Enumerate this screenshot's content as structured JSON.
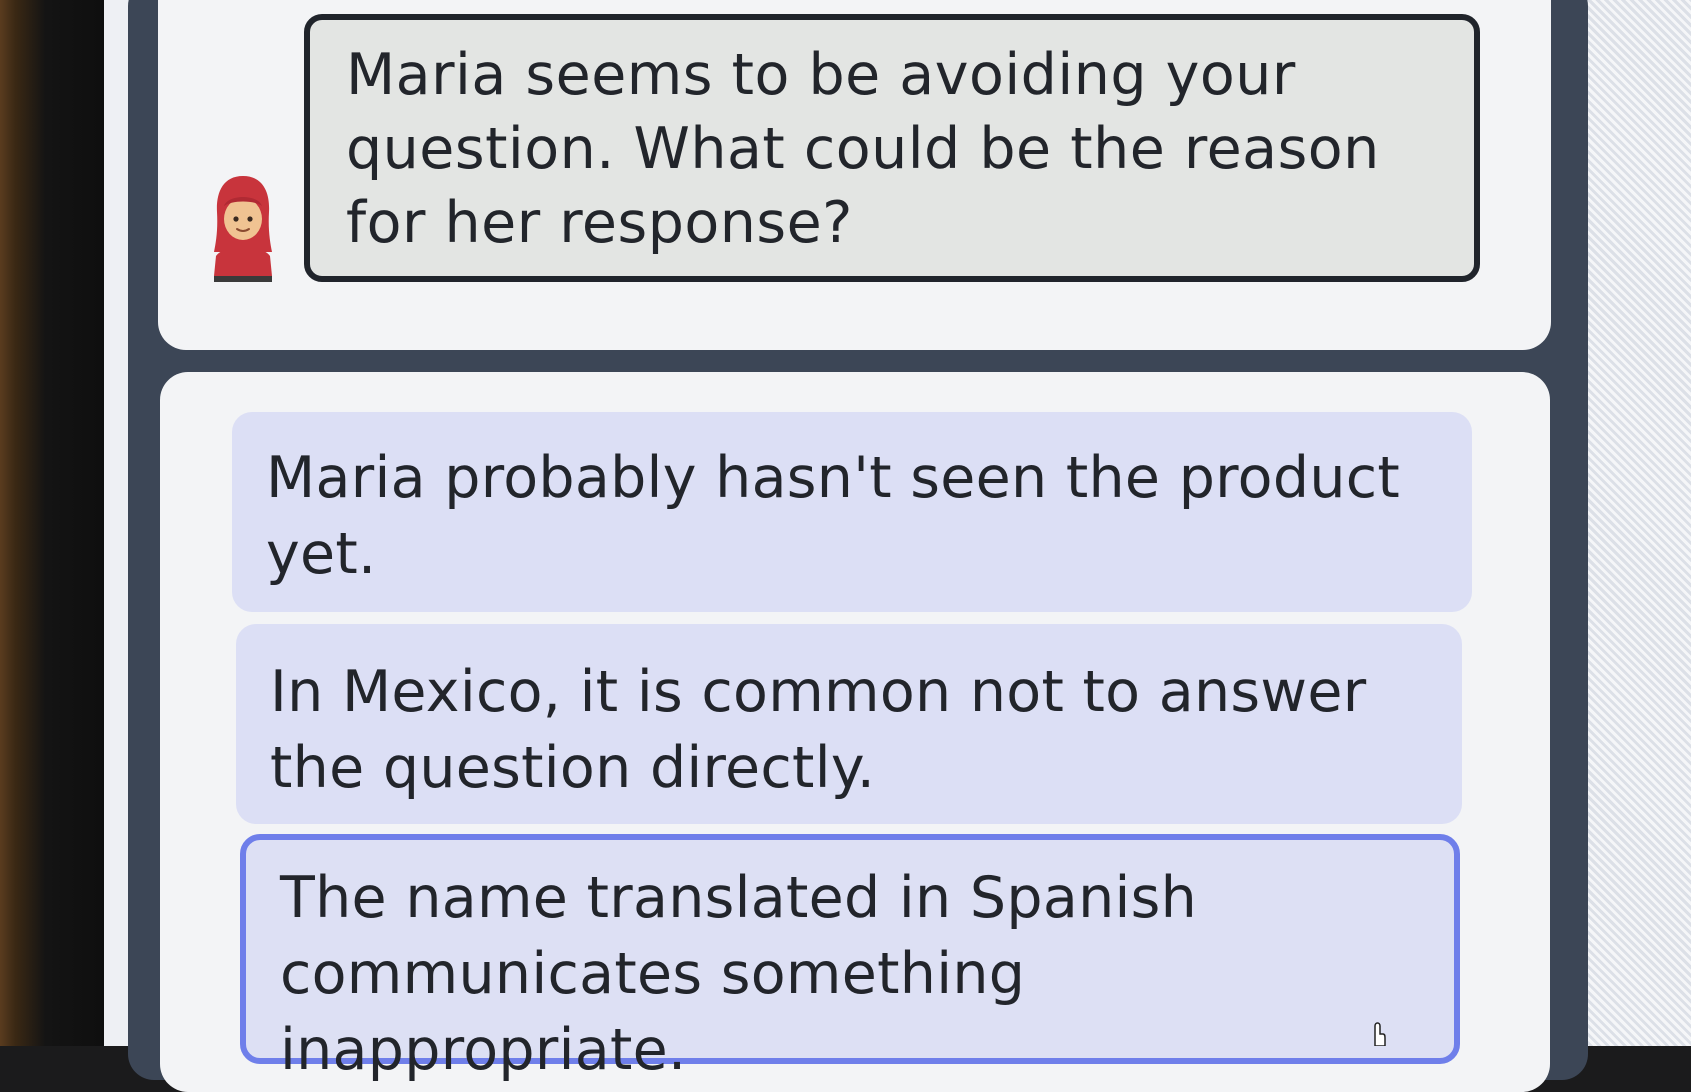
{
  "prompt": {
    "text": "Maria seems to be avoiding your question. What could be the reason for her response?",
    "avatar_icon": "woman-with-headscarf-icon"
  },
  "options": [
    {
      "text": "Maria probably hasn't seen the product yet."
    },
    {
      "text": "In Mexico, it is common not to answer the question directly."
    },
    {
      "text": "The name translated in Spanish communicates something inappropriate.",
      "state": "hovered"
    }
  ],
  "colors": {
    "frame": "#3c4656",
    "card": "#f3f4f6",
    "prompt_box_bg": "#e3e5e3",
    "prompt_border": "#20242b",
    "option_bg": "#dcdff5",
    "option_hover_border": "#6f7fea",
    "text": "#22252b"
  }
}
